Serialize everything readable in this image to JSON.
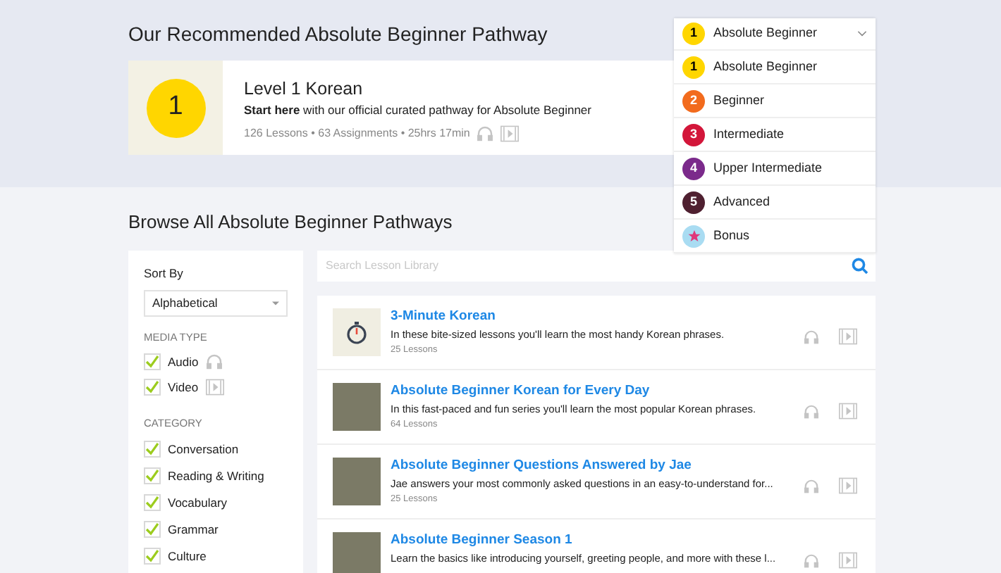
{
  "recommended": {
    "title": "Our Recommended Absolute Beginner Pathway",
    "badge": "1",
    "name": "Level 1 Korean",
    "description": "**Start here** with our official curated pathway for Absolute Beginner",
    "meta": "126 Lessons • 63 Assignments • 25hrs 17min"
  },
  "level_dropdown": {
    "expanded": true,
    "current": {
      "badge": "1",
      "label": "Absolute Beginner",
      "color": "#ffd600"
    },
    "options": [
      {
        "kind": "number",
        "badge": "1",
        "label": "Absolute Beginner",
        "color": "#ffd600"
      },
      {
        "kind": "number",
        "badge": "2",
        "label": "Beginner",
        "color": "#f26b1d"
      },
      {
        "kind": "number",
        "badge": "3",
        "label": "Intermediate",
        "color": "#d3163a"
      },
      {
        "kind": "number",
        "badge": "4",
        "label": "Upper Intermediate",
        "color": "#7b2a8b"
      },
      {
        "kind": "number",
        "badge": "5",
        "label": "Advanced",
        "color": "#4f2030"
      },
      {
        "kind": "star",
        "label": "Bonus",
        "color": "#a9dcf2"
      }
    ]
  },
  "browse": {
    "title": "Browse All Absolute Beginner Pathways"
  },
  "filters": {
    "sort_label": "Sort By",
    "sort_value": "Alphabetical",
    "media_heading": "MEDIA TYPE",
    "media": [
      {
        "label": "Audio",
        "kind": "audio",
        "checked": true
      },
      {
        "label": "Video",
        "kind": "video",
        "checked": true
      }
    ],
    "category_heading": "CATEGORY",
    "categories": [
      {
        "label": "Conversation",
        "checked": true
      },
      {
        "label": "Reading & Writing",
        "checked": true
      },
      {
        "label": "Vocabulary",
        "checked": true
      },
      {
        "label": "Grammar",
        "checked": true
      },
      {
        "label": "Culture",
        "checked": true
      }
    ]
  },
  "search": {
    "placeholder": "Search Lesson Library"
  },
  "series": [
    {
      "kind": "stopwatch",
      "title": "3-Minute Korean",
      "description": "In these bite-sized lessons you'll learn the most handy Korean phrases.",
      "count": "25 Lessons"
    },
    {
      "kind": "photo",
      "title": "Absolute Beginner Korean for Every Day",
      "description": "In this fast-paced and fun series you'll learn the most popular Korean phrases.",
      "count": "64 Lessons"
    },
    {
      "kind": "photo",
      "title": "Absolute Beginner Questions Answered by Jae",
      "description": "Jae answers your most commonly asked questions in an easy-to-understand for...",
      "count": "25 Lessons"
    },
    {
      "kind": "photo",
      "title": "Absolute Beginner Season 1",
      "description": "Learn the basics like introducing yourself, greeting people, and more with these l..."
    }
  ]
}
